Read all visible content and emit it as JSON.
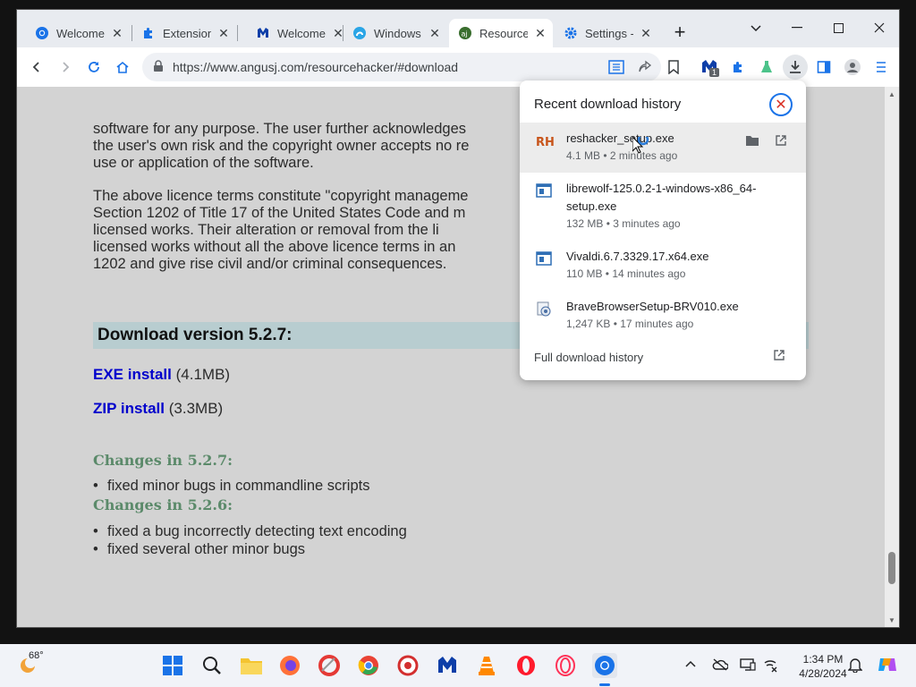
{
  "tabs": [
    {
      "title": "Welcome",
      "icon": "chrome-icon"
    },
    {
      "title": "Extensions",
      "icon": "puzzle-icon"
    },
    {
      "title": "Welcome",
      "icon": "malwarebytes-icon"
    },
    {
      "title": "Windows",
      "icon": "edge-icon"
    },
    {
      "title": "Resource",
      "icon": "aj-icon",
      "active": true
    },
    {
      "title": "Settings -",
      "icon": "gear-icon"
    }
  ],
  "address_bar": {
    "url": "https://www.angusj.com/resourcehacker/#download"
  },
  "extension_badge": "1",
  "page": {
    "para1": "software for any purpose. The user further acknowledges that the user's own risk and the copyright owner accepts no responsibility for any use or application of the software.",
    "para1_lines": [
      "software for any purpose. The user further acknowledges",
      "the user's own risk and the copyright owner accepts no re",
      "use or application of the software."
    ],
    "para2_lines": [
      "The above licence terms constitute \"copyright manageme",
      "Section 1202 of Title 17 of the United States Code and m",
      "licensed works. Their alteration or removal from the li",
      "licensed works without all the above licence terms in an",
      "1202 and give rise civil and/or criminal consequences."
    ],
    "download_heading": "Download version 5.2.7:",
    "exe_link": "EXE install",
    "exe_size": "(4.1MB)",
    "zip_link": "ZIP install",
    "zip_size": "(3.3MB)",
    "changes": [
      {
        "heading": "Changes in 5.2.7:",
        "items": [
          "fixed minor bugs in commandline scripts"
        ]
      },
      {
        "heading": "Changes in 5.2.6:",
        "items": [
          "fixed a bug incorrectly detecting text encoding",
          "fixed several other minor bugs"
        ]
      }
    ]
  },
  "downloads_popup": {
    "title": "Recent download history",
    "items": [
      {
        "name": "reshacker_setup.exe",
        "meta": "4.1 MB • 2 minutes ago"
      },
      {
        "name": "librewolf-125.0.2-1-windows-x86_64-setup.exe",
        "meta": "132 MB • 3 minutes ago"
      },
      {
        "name": "Vivaldi.6.7.3329.17.x64.exe",
        "meta": "110 MB • 14 minutes ago"
      },
      {
        "name": "BraveBrowserSetup-BRV010.exe",
        "meta": "1,247 KB • 17 minutes ago"
      }
    ],
    "full_history": "Full download history"
  },
  "taskbar": {
    "temperature": "68°",
    "time": "1:34 PM",
    "date": "4/28/2024"
  }
}
